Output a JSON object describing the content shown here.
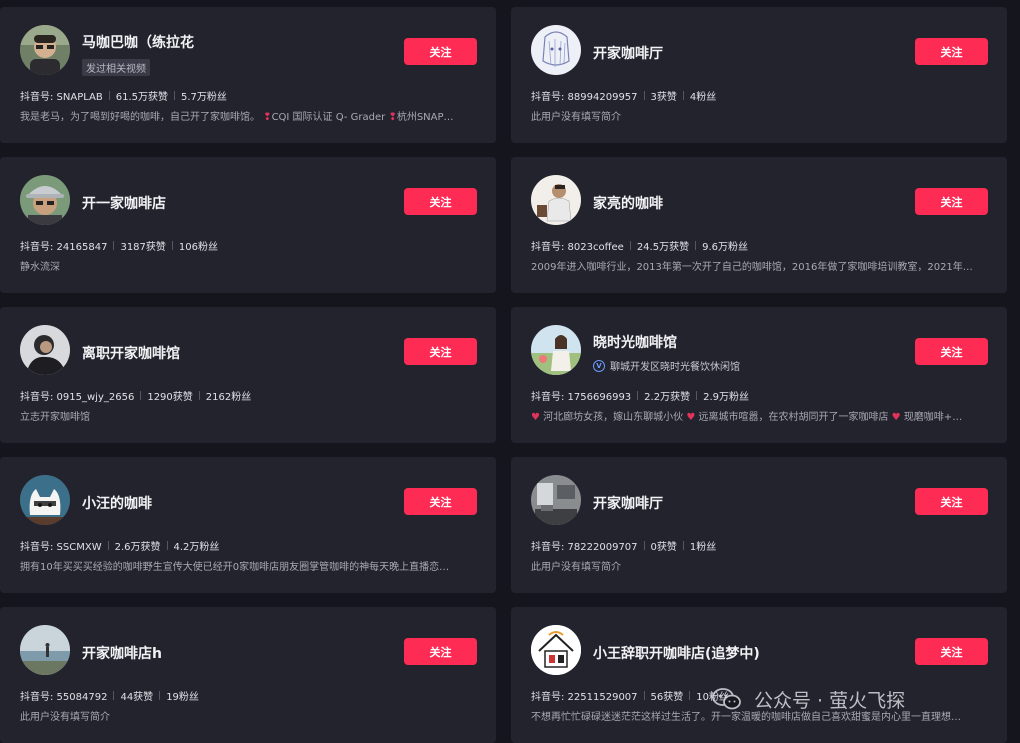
{
  "follow_label": "关注",
  "accent": "#fe2c55",
  "cards": [
    {
      "name": "马咖巴咖（练拉花",
      "sub_tag": "发过相关视频",
      "douyin_id": "抖音号: SNAPLAB",
      "likes": "61.5万获赞",
      "fans": "5.7万粉丝",
      "desc_parts": [
        "我是老马，为了喝到好喝的咖啡，自己开了家咖啡馆。",
        "CQI 国际认证 Q- Grader",
        "杭州SNAP…"
      ],
      "avatar": "man-glasses-avatar"
    },
    {
      "name": "开家咖啡厅",
      "douyin_id": "抖音号: 88994209957",
      "likes": "3获赞",
      "fans": "4粉丝",
      "desc": "此用户没有填写简介",
      "avatar": "anime-sketch-avatar"
    },
    {
      "name": "开一家咖啡店",
      "douyin_id": "抖音号: 24165847",
      "likes": "3187获赞",
      "fans": "106粉丝",
      "desc": "静水流深",
      "avatar": "man-hat-avatar"
    },
    {
      "name": "家亮的咖啡",
      "douyin_id": "抖音号: 8023coffee",
      "likes": "24.5万获赞",
      "fans": "9.6万粉丝",
      "desc": "2009年进入咖啡行业，2013年第一次开了自己的咖啡馆，2016年做了家咖啡培训教室，2021年…",
      "avatar": "barista-avatar"
    },
    {
      "name": "离职开家咖啡馆",
      "douyin_id": "抖音号: 0915_wjy_2656",
      "likes": "1290获赞",
      "fans": "2162粉丝",
      "desc": "立志开家咖啡馆",
      "avatar": "person-dark-avatar"
    },
    {
      "name": "晓时光咖啡馆",
      "verified": "聊城开发区晓时光餐饮休闲馆",
      "douyin_id": "抖音号: 1756696993",
      "likes": "2.2万获赞",
      "fans": "2.9万粉丝",
      "desc_parts": [
        "河北廊坊女孩，嫁山东聊城小伙",
        "远离城市喧嚣，在农村胡同开了一家咖啡店",
        "现磨咖啡+…"
      ],
      "avatar": "woman-field-avatar"
    },
    {
      "name": "小汪的咖啡",
      "douyin_id": "抖音号: SSCMXW",
      "likes": "2.6万获赞",
      "fans": "4.2万粉丝",
      "desc": "拥有10年买买买经验的咖啡野生宣传大使已经开0家咖啡店朋友圈掌管咖啡的神每天晚上直播恋…",
      "avatar": "cat-avatar"
    },
    {
      "name": "开家咖啡厅",
      "douyin_id": "抖音号: 78222009707",
      "likes": "0获赞",
      "fans": "1粉丝",
      "desc": "此用户没有填写简介",
      "avatar": "interior-avatar"
    },
    {
      "name": "开家咖啡店h",
      "douyin_id": "抖音号: 55084792",
      "likes": "44获赞",
      "fans": "19粉丝",
      "desc": "此用户没有填写简介",
      "avatar": "seaside-avatar"
    },
    {
      "name": "小王辞职开咖啡店(追梦中)",
      "douyin_id": "抖音号: 22511529007",
      "likes": "56获赞",
      "fans": "10粉丝",
      "desc": "不想再忙忙碌碌迷迷茫茫这样过生活了。开一家温暖的咖啡店做自己喜欢甜蜜是内心里一直理想…",
      "avatar": "logo-avatar"
    }
  ],
  "watermark": {
    "text": "公众号 · 萤火飞探",
    "icon": "wechat-icon"
  }
}
